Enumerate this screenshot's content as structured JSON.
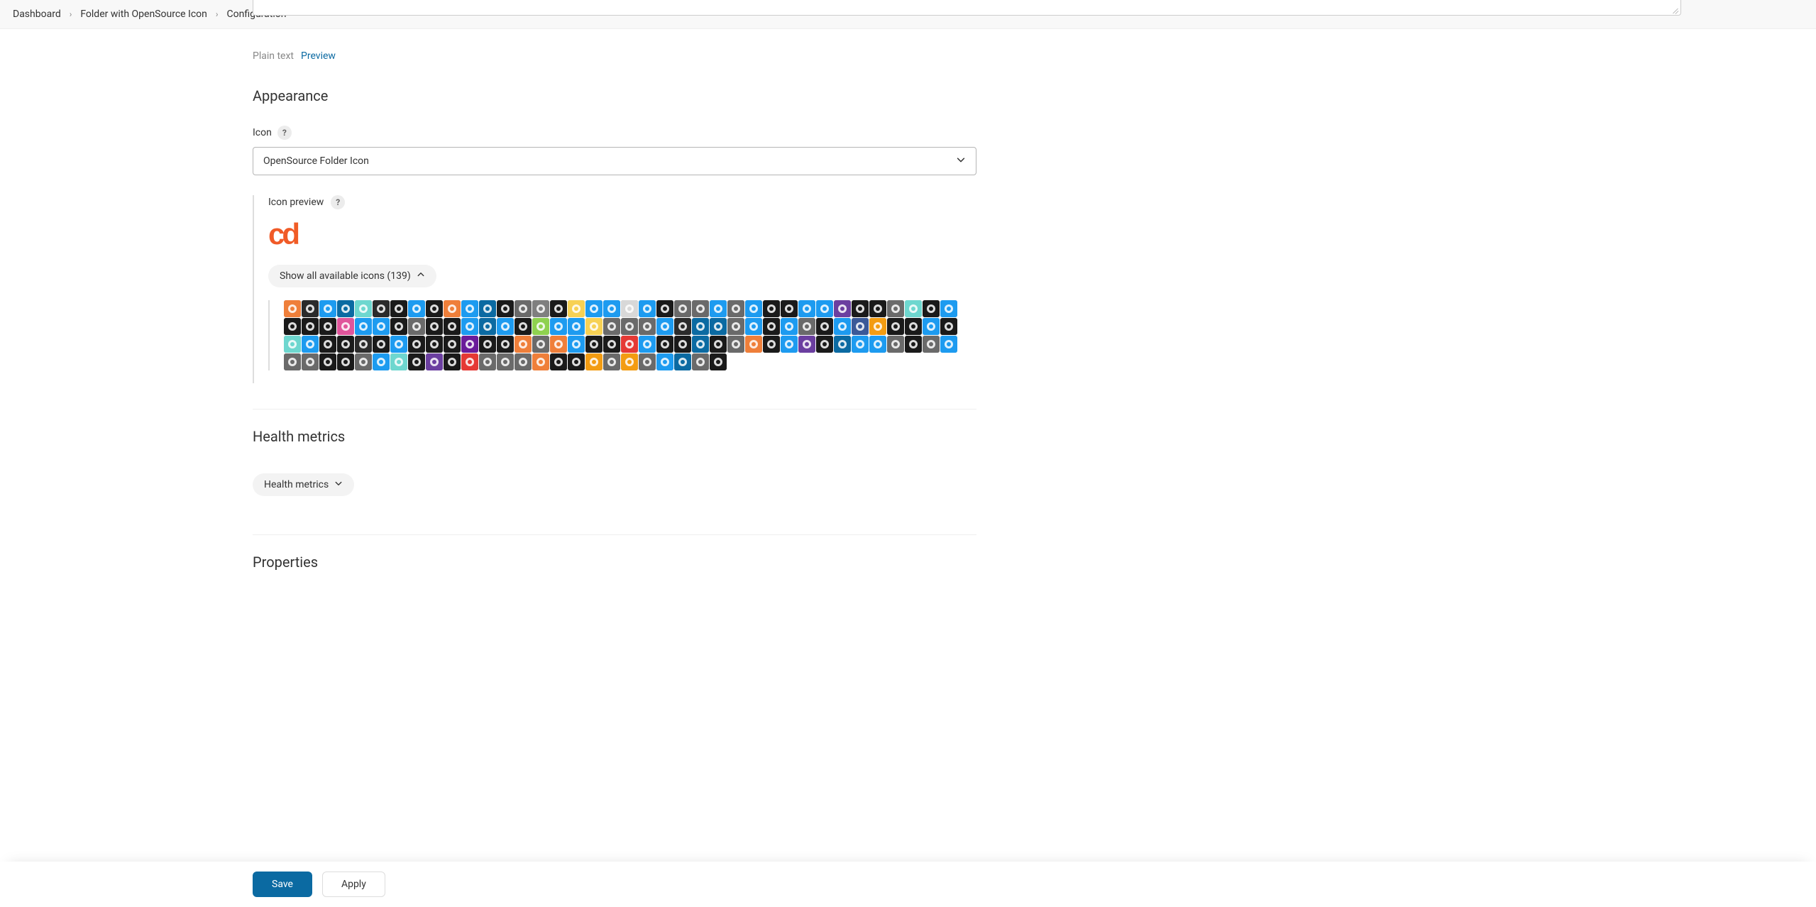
{
  "breadcrumb": {
    "items": [
      "Dashboard",
      "Folder with OpenSource Icon",
      "Configuration"
    ]
  },
  "tabs": {
    "plain": "Plain text",
    "preview": "Preview"
  },
  "appearance": {
    "title": "Appearance",
    "icon_label": "Icon",
    "selected": "OpenSource Folder Icon",
    "preview_label": "Icon preview",
    "show_all_label": "Show all available icons (139)",
    "icon_count": 139
  },
  "health": {
    "title": "Health metrics",
    "pill": "Health metrics"
  },
  "properties": {
    "title": "Properties"
  },
  "buttons": {
    "save": "Save",
    "apply": "Apply"
  },
  "icon_palette": [
    "#ef7f3a",
    "#2b2b2b",
    "#1d9bf0",
    "#0b6aa2",
    "#6ed7cf",
    "#2b2b2b",
    "#1a1a1a",
    "#1d9bf0",
    "#1a1a1a",
    "#ef7f3a",
    "#1d9bf0",
    "#0b6aa2",
    "#1a1a1a",
    "#6a6a6a",
    "#7f7f7f",
    "#1a1a1a",
    "#f7d154",
    "#1d9bf0",
    "#1d9bf0",
    "#d8d8d8",
    "#1d9bf0",
    "#1a1a1a",
    "#6a6a6a",
    "#6a6a6a",
    "#1d9bf0",
    "#6a6a6a",
    "#1d9bf0",
    "#1a1a1a",
    "#1a1a1a",
    "#1d9bf0",
    "#1d9bf0",
    "#6b3fa0",
    "#1a1a1a",
    "#1a1a1a",
    "#6a6a6a",
    "#6ed7cf",
    "#1a1a1a",
    "#1d9bf0",
    "#1a1a1a",
    "#1a1a1a",
    "#1a1a1a",
    "#e0559b",
    "#1d9bf0",
    "#1d9bf0",
    "#1a1a1a",
    "#6a6a6a",
    "#1a1a1a",
    "#1a1a1a",
    "#1d9bf0",
    "#0b6aa2",
    "#1d9bf0",
    "#1a1a1a",
    "#8fd14f",
    "#1d9bf0",
    "#1d9bf0",
    "#f7d154",
    "#6a6a6a",
    "#6a6a6a",
    "#6a6a6a",
    "#1d9bf0",
    "#2b2b2b",
    "#0b6aa2",
    "#0b6aa2",
    "#6a6a6a",
    "#1d9bf0",
    "#1a1a1a",
    "#1d9bf0",
    "#6a6a6a",
    "#1a1a1a",
    "#1d9bf0",
    "#3b5998",
    "#f39c12",
    "#1a1a1a",
    "#1a1a1a",
    "#1d9bf0",
    "#1a1a1a",
    "#6ed7cf",
    "#1d9bf0",
    "#1a1a1a",
    "#1a1a1a",
    "#2b2b2b",
    "#1a1a1a",
    "#1d9bf0",
    "#1a1a1a",
    "#1a1a1a",
    "#1a1a1a",
    "#6a1b9a",
    "#1a1a1a",
    "#1a1a1a",
    "#ef7f3a",
    "#6a6a6a",
    "#ef7f3a",
    "#1d9bf0",
    "#1a1a1a",
    "#1a1a1a",
    "#e53935",
    "#1d9bf0",
    "#1a1a1a",
    "#1a1a1a",
    "#0b6aa2",
    "#1a1a1a",
    "#6a6a6a",
    "#ef7f3a",
    "#1a1a1a",
    "#1d9bf0",
    "#6b3fa0",
    "#1a1a1a",
    "#0b6aa2",
    "#1d9bf0",
    "#1d9bf0",
    "#6a6a6a",
    "#1a1a1a",
    "#6a6a6a",
    "#1d9bf0",
    "#6a6a6a",
    "#6a6a6a",
    "#1a1a1a",
    "#1a1a1a",
    "#6a6a6a",
    "#1d9bf0",
    "#6ed7cf",
    "#1a1a1a",
    "#6b3fa0",
    "#1a1a1a",
    "#e53935",
    "#6a6a6a",
    "#6a6a6a",
    "#6a6a6a",
    "#ef7f3a",
    "#1a1a1a",
    "#1a1a1a",
    "#f39c12",
    "#6a6a6a",
    "#f39c12",
    "#6a6a6a",
    "#1d9bf0",
    "#0b6aa2",
    "#6a6a6a",
    "#1a1a1a"
  ]
}
